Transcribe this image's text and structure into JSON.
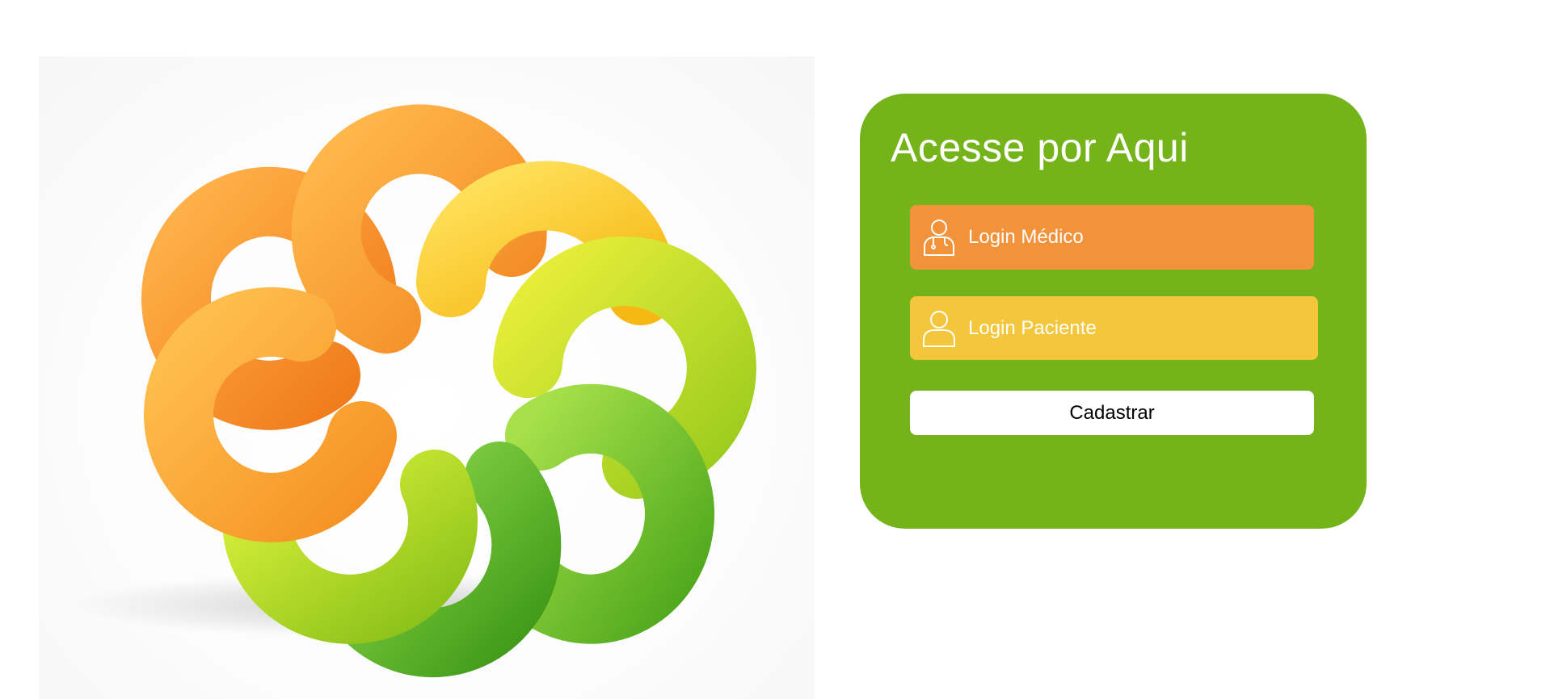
{
  "card": {
    "title": "Acesse por Aqui",
    "accent_color": "#75b31b"
  },
  "buttons": {
    "medico": {
      "label": "Login Médico",
      "icon": "doctor-user-icon",
      "color": "#f2923a"
    },
    "paciente": {
      "label": "Login Paciente",
      "icon": "user-icon",
      "color": "#f4c63b"
    },
    "cadastrar": {
      "label": "Cadastrar",
      "color": "#ffffff"
    }
  },
  "hero": {
    "image": "colorful-rings-logo"
  }
}
